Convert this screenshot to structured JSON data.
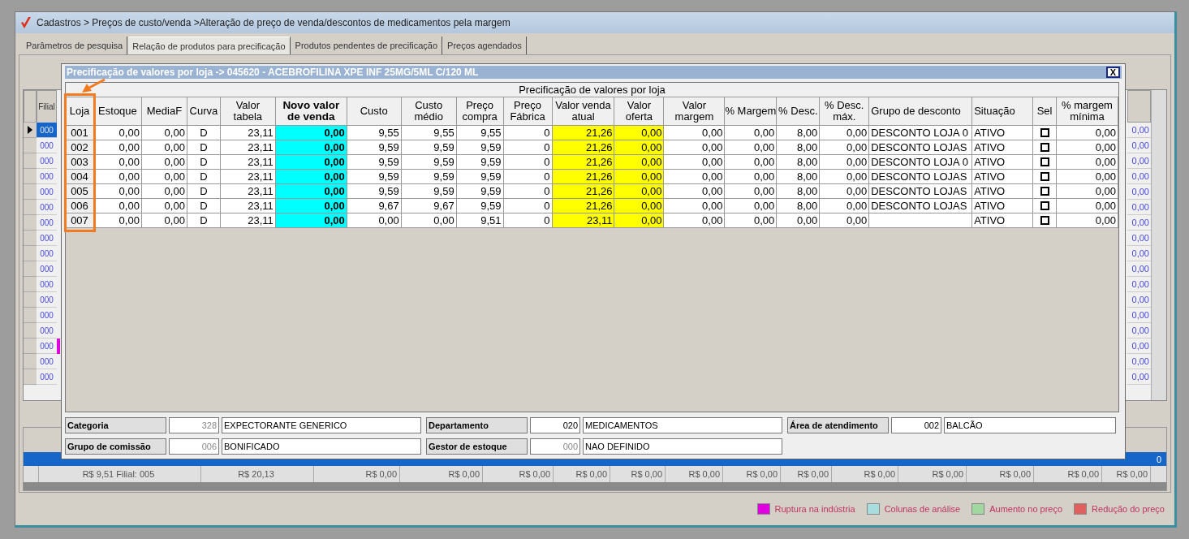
{
  "window": {
    "title": "Cadastros > Preços de custo/venda >Alteração de preço de venda/descontos de medicamentos pela margem"
  },
  "tabs": [
    {
      "label": "Parâmetros de pesquisa",
      "selected": false
    },
    {
      "label": "Relação de produtos para precificação",
      "selected": true
    },
    {
      "label": "Produtos pendentes de precificação",
      "selected": false
    },
    {
      "label": "Preços agendados",
      "selected": false
    }
  ],
  "product_grid": {
    "header": "Filial",
    "rows": [
      {
        "code": "000",
        "selected": true,
        "rupture": false
      },
      {
        "code": "000",
        "selected": false,
        "rupture": false
      },
      {
        "code": "000",
        "selected": false,
        "rupture": false
      },
      {
        "code": "000",
        "selected": false,
        "rupture": false
      },
      {
        "code": "000",
        "selected": false,
        "rupture": false
      },
      {
        "code": "000",
        "selected": false,
        "rupture": false
      },
      {
        "code": "000",
        "selected": false,
        "rupture": false
      },
      {
        "code": "000",
        "selected": false,
        "rupture": false
      },
      {
        "code": "000",
        "selected": false,
        "rupture": false
      },
      {
        "code": "000",
        "selected": false,
        "rupture": false
      },
      {
        "code": "000",
        "selected": false,
        "rupture": false
      },
      {
        "code": "000",
        "selected": false,
        "rupture": false
      },
      {
        "code": "000",
        "selected": false,
        "rupture": false
      },
      {
        "code": "000",
        "selected": false,
        "rupture": false
      },
      {
        "code": "000",
        "selected": false,
        "rupture": true
      },
      {
        "code": "000",
        "selected": false,
        "rupture": false
      },
      {
        "code": "000",
        "selected": false,
        "rupture": false
      }
    ],
    "right_column": [
      "0,00",
      "0,00",
      "0,00",
      "0,00",
      "0,00",
      "0,00",
      "0,00",
      "0,00",
      "0,00",
      "0,00",
      "0,00",
      "0,00",
      "0,00",
      "0,00",
      "0,00",
      "0,00",
      "0,00"
    ]
  },
  "dados": {
    "selected_row_value": "0",
    "summary": [
      "R$ 9,51 Filial: 005",
      "R$ 20,13",
      "R$ 0,00",
      "R$ 0,00",
      "R$ 0,00",
      "R$ 0,00",
      "R$ 0,00",
      "R$ 0,00",
      "R$ 0,00",
      "R$ 0,00",
      "R$ 0,00",
      "R$ 0,00",
      "R$ 0,00",
      "R$ 0,00",
      "R$ 0,00"
    ]
  },
  "legend": [
    {
      "label": "Ruptura na indústria",
      "color": "#e000e0"
    },
    {
      "label": "Colunas de análise",
      "color": "#a8dde0"
    },
    {
      "label": "Aumento no preço",
      "color": "#a0d8a0"
    },
    {
      "label": "Redução do preço",
      "color": "#e06060"
    }
  ],
  "dialog": {
    "title": "Precificação de valores por loja -> 045620 - ACEBROFILINA XPE INF 25MG/5ML C/120 ML",
    "close": "X",
    "grid_caption": "Precificação de valores por loja",
    "columns": [
      {
        "label": "Loja",
        "kind": "code"
      },
      {
        "label": "Estoque",
        "kind": "number"
      },
      {
        "label": "MediaF",
        "kind": "number"
      },
      {
        "label": "Curva",
        "kind": "code"
      },
      {
        "label": "Valor tabela",
        "kind": "number"
      },
      {
        "label": "Novo valor de venda",
        "kind": "new-price"
      },
      {
        "label": "Custo",
        "kind": "number"
      },
      {
        "label": "Custo médio",
        "kind": "number"
      },
      {
        "label": "Preço compra",
        "kind": "number"
      },
      {
        "label": "Preço Fábrica",
        "kind": "number"
      },
      {
        "label": "Valor venda atual",
        "kind": "current-price"
      },
      {
        "label": "Valor oferta",
        "kind": "current-price"
      },
      {
        "label": "Valor margem",
        "kind": "number"
      },
      {
        "label": "% Margem",
        "kind": "number"
      },
      {
        "label": "% Desc.",
        "kind": "number"
      },
      {
        "label": "% Desc. máx.",
        "kind": "number"
      },
      {
        "label": "Grupo de desconto",
        "kind": "text"
      },
      {
        "label": "Situação",
        "kind": "text"
      },
      {
        "label": "Sel",
        "kind": "checkbox"
      },
      {
        "label": "% margem mínima",
        "kind": "number"
      }
    ],
    "rows": [
      {
        "cells": [
          "001",
          "0,00",
          "0,00",
          "D",
          "23,11",
          "0,00",
          "9,55",
          "9,55",
          "9,55",
          "0",
          "21,26",
          "0,00",
          "0,00",
          "0,00",
          "8,00",
          "0,00",
          "DESCONTO LOJA 0",
          "ATIVO",
          "0,00"
        ],
        "checked": false
      },
      {
        "cells": [
          "002",
          "0,00",
          "0,00",
          "D",
          "23,11",
          "0,00",
          "9,59",
          "9,59",
          "9,59",
          "0",
          "21,26",
          "0,00",
          "0,00",
          "0,00",
          "8,00",
          "0,00",
          "DESCONTO LOJAS",
          "ATIVO",
          "0,00"
        ],
        "checked": false
      },
      {
        "cells": [
          "003",
          "0,00",
          "0,00",
          "D",
          "23,11",
          "0,00",
          "9,59",
          "9,59",
          "9,59",
          "0",
          "21,26",
          "0,00",
          "0,00",
          "0,00",
          "8,00",
          "0,00",
          "DESCONTO LOJA 0",
          "ATIVO",
          "0,00"
        ],
        "checked": false
      },
      {
        "cells": [
          "004",
          "0,00",
          "0,00",
          "D",
          "23,11",
          "0,00",
          "9,59",
          "9,59",
          "9,59",
          "0",
          "21,26",
          "0,00",
          "0,00",
          "0,00",
          "8,00",
          "0,00",
          "DESCONTO LOJAS",
          "ATIVO",
          "0,00"
        ],
        "checked": false
      },
      {
        "cells": [
          "005",
          "0,00",
          "0,00",
          "D",
          "23,11",
          "0,00",
          "9,59",
          "9,59",
          "9,59",
          "0",
          "21,26",
          "0,00",
          "0,00",
          "0,00",
          "8,00",
          "0,00",
          "DESCONTO LOJAS",
          "ATIVO",
          "0,00"
        ],
        "checked": false
      },
      {
        "cells": [
          "006",
          "0,00",
          "0,00",
          "D",
          "23,11",
          "0,00",
          "9,67",
          "9,67",
          "9,59",
          "0",
          "21,26",
          "0,00",
          "0,00",
          "0,00",
          "8,00",
          "0,00",
          "DESCONTO LOJAS",
          "ATIVO",
          "0,00"
        ],
        "checked": false
      },
      {
        "cells": [
          "007",
          "0,00",
          "0,00",
          "D",
          "23,11",
          "0,00",
          "0,00",
          "0,00",
          "9,51",
          "0",
          "23,11",
          "0,00",
          "0,00",
          "0,00",
          "0,00",
          "0,00",
          null,
          "ATIVO",
          "0,00"
        ],
        "checked": false
      }
    ],
    "fields": [
      [
        {
          "label": "Categoria",
          "code": "328",
          "code_disabled": true,
          "description": "EXPECTORANTE GENERICO"
        },
        {
          "label": "Departamento",
          "code": "020",
          "code_disabled": false,
          "description": "MEDICAMENTOS"
        },
        {
          "label": "Área de atendimento",
          "code": "002",
          "code_disabled": false,
          "description": "BALCÃO"
        }
      ],
      [
        {
          "label": "Grupo de comissão",
          "code": "006",
          "code_disabled": true,
          "description": "BONIFICADO"
        },
        {
          "label": "Gestor de estoque",
          "code": "000",
          "code_disabled": true,
          "description": "NAO DEFINIDO"
        }
      ]
    ]
  }
}
